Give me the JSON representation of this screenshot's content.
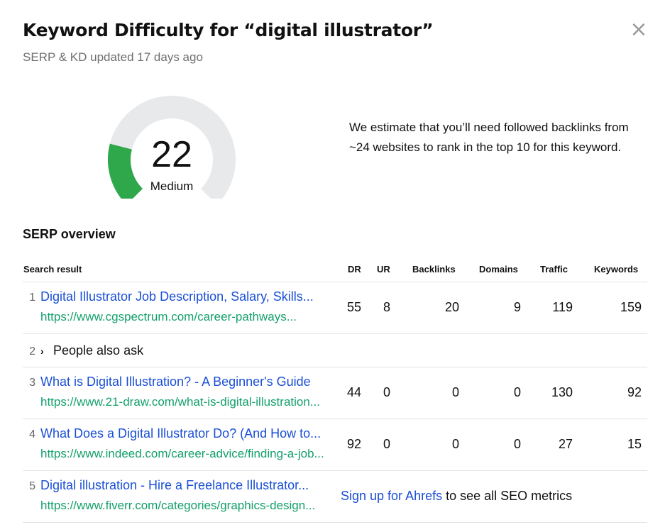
{
  "header": {
    "title": "Keyword Difficulty for “digital illustrator”",
    "subtitle": "SERP & KD updated 17 days ago",
    "close_glyph": "×"
  },
  "difficulty": {
    "score": "22",
    "label": "Medium",
    "score_fraction": 0.22,
    "fill_color": "#2ea84a",
    "track_color": "#e8e9eb",
    "estimate": "We estimate that you’ll need followed backlinks from ~24 websites to rank in the top 10 for this keyword."
  },
  "serp": {
    "section_title": "SERP overview",
    "columns": {
      "search_result": "Search result",
      "dr": "DR",
      "ur": "UR",
      "backlinks": "Backlinks",
      "domains": "Domains",
      "traffic": "Traffic",
      "keywords": "Keywords"
    },
    "rows": [
      {
        "rank": "1",
        "title": "Digital Illustrator Job Description, Salary, Skills...",
        "url": "https://www.cgspectrum.com/career-pathways...",
        "dr": "55",
        "ur": "8",
        "backlinks": "20",
        "domains": "9",
        "traffic": "119",
        "keywords": "159"
      },
      {
        "rank": "2",
        "paa_label": "People also ask"
      },
      {
        "rank": "3",
        "title": "What is Digital Illustration? - A Beginner's Guide",
        "url": "https://www.21-draw.com/what-is-digital-illustration...",
        "dr": "44",
        "ur": "0",
        "backlinks": "0",
        "domains": "0",
        "traffic": "130",
        "keywords": "92"
      },
      {
        "rank": "4",
        "title": "What Does a Digital Illustrator Do? (And How to...",
        "url": "https://www.indeed.com/career-advice/finding-a-job...",
        "dr": "92",
        "ur": "0",
        "backlinks": "0",
        "domains": "0",
        "traffic": "27",
        "keywords": "15"
      },
      {
        "rank": "5",
        "title": "Digital illustration - Hire a Freelance Illustrator...",
        "url": "https://www.fiverr.com/categories/graphics-design...",
        "signup_link": "Sign up for Ahrefs",
        "signup_rest": " to see all SEO metrics"
      }
    ]
  }
}
